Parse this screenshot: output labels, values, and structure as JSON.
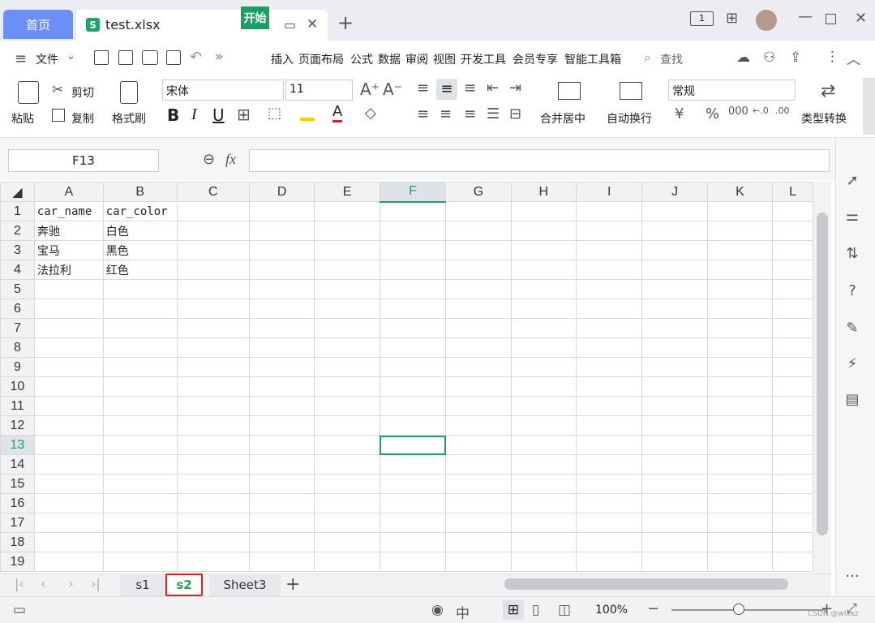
{
  "tabs": {
    "home": "首页",
    "file": "test.xlsx",
    "file_icon": "S"
  },
  "menu": {
    "file": "文件",
    "start": "开始",
    "items": [
      "插入",
      "页面布局",
      "公式",
      "数据",
      "审阅",
      "视图",
      "开发工具",
      "会员专享",
      "智能工具箱"
    ],
    "search": "查找"
  },
  "ribbon": {
    "paste": "粘贴",
    "cut": "剪切",
    "copy": "复制",
    "format_painter": "格式刷",
    "font": "宋体",
    "size": "11",
    "merge": "合并居中",
    "wrap": "自动换行",
    "number_format": "常规",
    "convert": "类型转换"
  },
  "formula": {
    "cell_ref": "F13",
    "fx": "fx",
    "content": ""
  },
  "columns": [
    "A",
    "B",
    "C",
    "D",
    "E",
    "F",
    "G",
    "H",
    "I",
    "J",
    "K",
    "L"
  ],
  "rows": [
    [
      "car_name",
      "car_color"
    ],
    [
      "奔驰",
      "白色"
    ],
    [
      "宝马",
      "黑色"
    ],
    [
      "法拉利",
      "红色"
    ]
  ],
  "row_numbers": [
    "1",
    "2",
    "3",
    "4",
    "5",
    "6",
    "7",
    "8",
    "9",
    "10",
    "11",
    "12",
    "13",
    "14",
    "15",
    "16",
    "17",
    "18",
    "19"
  ],
  "sheets": [
    "s1",
    "s2",
    "Sheet3"
  ],
  "active_sheet": "s2",
  "status": {
    "zoom": "100%",
    "watermark": "CSDN @wlxxz"
  },
  "accent": "#1e9e63"
}
